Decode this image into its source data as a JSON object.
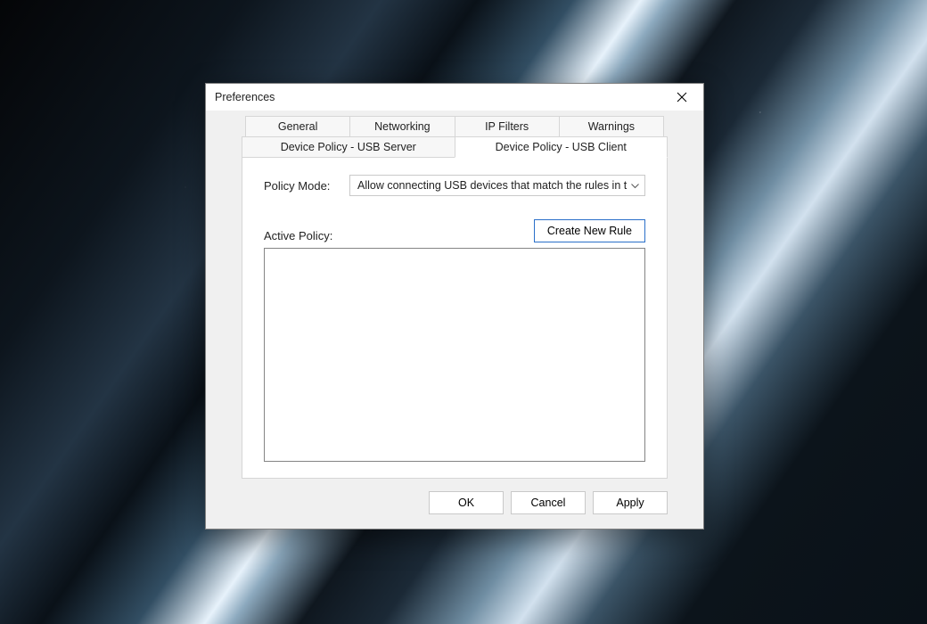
{
  "window": {
    "title": "Preferences"
  },
  "tabs_row1": [
    "General",
    "Networking",
    "IP Filters",
    "Warnings"
  ],
  "tabs_row2": [
    "Device Policy - USB Server",
    "Device Policy - USB Client"
  ],
  "active_tab": "Device Policy - USB Client",
  "policy_mode": {
    "label": "Policy Mode:",
    "value": "Allow connecting USB devices that match the rules in the list below"
  },
  "active_policy_label": "Active Policy:",
  "buttons": {
    "create_rule": "Create New Rule",
    "ok": "OK",
    "cancel": "Cancel",
    "apply": "Apply"
  }
}
